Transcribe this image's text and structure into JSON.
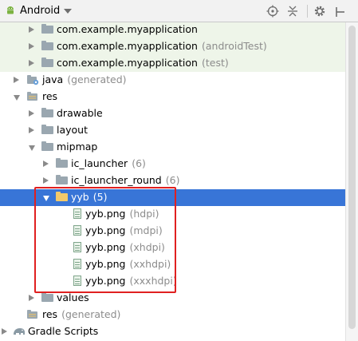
{
  "toolbar": {
    "title": "Android",
    "icons": [
      "android-icon",
      "scroll-from-source-icon",
      "collapse-all-icon",
      "settings-gear-icon",
      "hide-icon"
    ]
  },
  "tree": {
    "rows": [
      {
        "label": "com.example.myapplication",
        "suffix": ""
      },
      {
        "label": "com.example.myapplication",
        "suffix": "(androidTest)"
      },
      {
        "label": "com.example.myapplication",
        "suffix": "(test)"
      },
      {
        "label": "java",
        "suffix": "(generated)"
      },
      {
        "label": "res",
        "suffix": ""
      },
      {
        "label": "drawable",
        "suffix": ""
      },
      {
        "label": "layout",
        "suffix": ""
      },
      {
        "label": "mipmap",
        "suffix": ""
      },
      {
        "label": "ic_launcher",
        "suffix": "(6)"
      },
      {
        "label": "ic_launcher_round",
        "suffix": "(6)"
      },
      {
        "label": "yyb",
        "suffix": "(5)"
      },
      {
        "label": "yyb.png",
        "suffix": "(hdpi)"
      },
      {
        "label": "yyb.png",
        "suffix": "(mdpi)"
      },
      {
        "label": "yyb.png",
        "suffix": "(xhdpi)"
      },
      {
        "label": "yyb.png",
        "suffix": "(xxhdpi)"
      },
      {
        "label": "yyb.png",
        "suffix": "(xxxhdpi)"
      },
      {
        "label": "values",
        "suffix": ""
      },
      {
        "label": "res",
        "suffix": "(generated)"
      },
      {
        "label": "Gradle Scripts",
        "suffix": ""
      }
    ]
  },
  "colors": {
    "selection": "#3875d7",
    "highlight_row": "#eef5e9",
    "annotation_box": "#e02020"
  }
}
